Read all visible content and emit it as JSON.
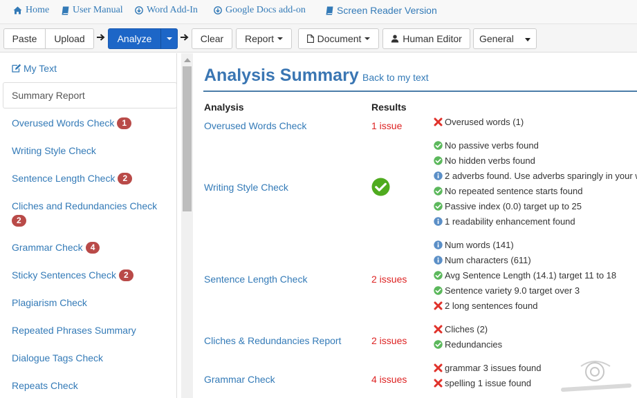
{
  "topnav": {
    "items": [
      {
        "label": "Home",
        "icon": "home-icon"
      },
      {
        "label": "User Manual",
        "icon": "book-icon"
      },
      {
        "label": "Word Add-In",
        "icon": "download-icon"
      },
      {
        "label": "Google Docs add-on",
        "icon": "download-icon"
      },
      {
        "label": "Screen Reader Version",
        "icon": "book-icon"
      }
    ]
  },
  "toolbar": {
    "paste": "Paste",
    "upload": "Upload",
    "analyze": "Analyze",
    "clear": "Clear",
    "report": "Report",
    "document": "Document",
    "human_editor": "Human Editor",
    "style_select": "General"
  },
  "sidebar": {
    "items": [
      {
        "label": "My Text"
      },
      {
        "label": "Summary Report"
      },
      {
        "label": "Overused Words Check",
        "badge": "1"
      },
      {
        "label": "Writing Style Check"
      },
      {
        "label": "Sentence Length Check",
        "badge": "2"
      },
      {
        "label": "Cliches and Redundancies Check",
        "badge": "2"
      },
      {
        "label": "Grammar Check",
        "badge": "4"
      },
      {
        "label": "Sticky Sentences Check",
        "badge": "2"
      },
      {
        "label": "Plagiarism Check"
      },
      {
        "label": "Repeated Phrases Summary"
      },
      {
        "label": "Dialogue Tags Check"
      },
      {
        "label": "Repeats Check"
      }
    ]
  },
  "main": {
    "title": "Analysis Summary",
    "back_link": "Back to my text",
    "col_analysis": "Analysis",
    "col_results": "Results",
    "rows": [
      {
        "name": "Overused Words Check",
        "result": "1 issue",
        "details": [
          {
            "status": "error",
            "text": "Overused words (1)"
          }
        ]
      },
      {
        "name": "Writing Style Check",
        "result": "",
        "details": [
          {
            "status": "ok",
            "text": "No passive verbs found"
          },
          {
            "status": "ok",
            "text": "No hidden verbs found"
          },
          {
            "status": "info",
            "text": "2 adverbs found. Use adverbs sparingly in your w"
          },
          {
            "status": "ok",
            "text": "No repeated sentence starts found"
          },
          {
            "status": "ok",
            "text": "Passive index (0.0) target up to 25"
          },
          {
            "status": "info",
            "text": "1 readability enhancement found"
          }
        ]
      },
      {
        "name": "Sentence Length Check",
        "result": "2 issues",
        "details": [
          {
            "status": "info",
            "text": "Num words (141)"
          },
          {
            "status": "info",
            "text": "Num characters (611)"
          },
          {
            "status": "ok",
            "text": "Avg Sentence Length (14.1) target 11 to 18"
          },
          {
            "status": "ok",
            "text": "Sentence variety 9.0 target over 3"
          },
          {
            "status": "error",
            "text": "2 long sentences found"
          }
        ]
      },
      {
        "name": "Cliches & Redundancies Report",
        "result": "2 issues",
        "details": [
          {
            "status": "error",
            "text": "Cliches (2)"
          },
          {
            "status": "ok",
            "text": "Redundancies"
          }
        ]
      },
      {
        "name": "Grammar Check",
        "result": "4 issues",
        "details": [
          {
            "status": "error",
            "text": "grammar 3 issues found"
          },
          {
            "status": "error",
            "text": "spelling 1 issue found"
          }
        ]
      }
    ]
  },
  "colors": {
    "link": "#337ab7",
    "primary": "#1d66c7",
    "badge": "#b94a48",
    "issue": "#dd2222",
    "ok": "#5cb85c",
    "info": "#5b8fc7"
  }
}
